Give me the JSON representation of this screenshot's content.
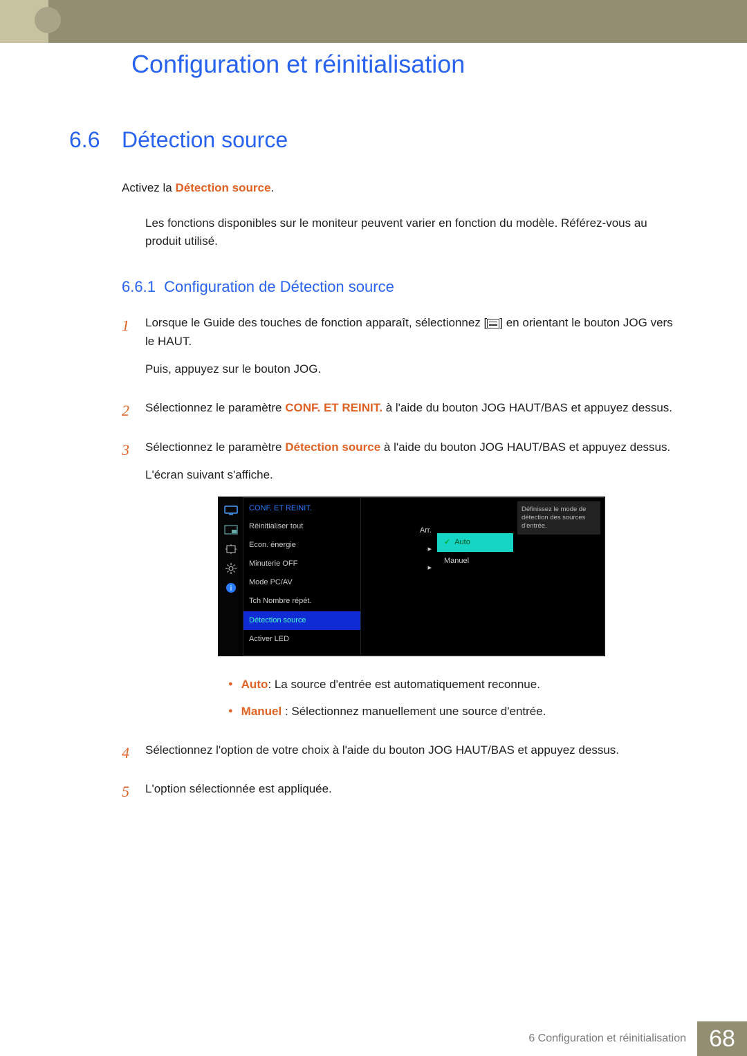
{
  "header": {
    "chapter_title": "Configuration et réinitialisation"
  },
  "section": {
    "number": "6.6",
    "title": "Détection source"
  },
  "intro": {
    "prefix": "Activez la ",
    "kw": "Détection source",
    "suffix": "."
  },
  "note": "Les fonctions disponibles sur le moniteur peuvent varier en fonction du modèle. Référez-vous au produit utilisé.",
  "subsection": {
    "number": "6.6.1",
    "title": "Configuration de Détection source"
  },
  "steps": {
    "s1": {
      "num": "1",
      "p1a": "Lorsque le Guide des touches de fonction apparaît, sélectionnez [",
      "p1b": "] en orientant le bouton JOG vers le HAUT.",
      "p2": "Puis, appuyez sur le bouton JOG."
    },
    "s2": {
      "num": "2",
      "p_a": "Sélectionnez le paramètre ",
      "kw": "CONF. ET REINIT.",
      "p_b": " à l'aide du bouton JOG HAUT/BAS et appuyez dessus."
    },
    "s3": {
      "num": "3",
      "p1_a": "Sélectionnez le paramètre ",
      "kw": "Détection source",
      "p1_b": " à l'aide du bouton JOG HAUT/BAS et appuyez dessus.",
      "p2": "L'écran suivant s'affiche."
    },
    "s4": {
      "num": "4",
      "p": "Sélectionnez l'option de votre choix à l'aide du bouton JOG HAUT/BAS et appuyez dessus."
    },
    "s5": {
      "num": "5",
      "p": "L'option sélectionnée est appliquée."
    }
  },
  "osd": {
    "header": "CONF. ET REINIT.",
    "rows": {
      "r1": "Réinitialiser tout",
      "r2": "Econ. énergie",
      "r3": "Minuterie OFF",
      "r4": "Mode PC/AV",
      "r5": "Tch Nombre répét.",
      "r6": "Détection source",
      "r7": "Activer LED"
    },
    "vals": {
      "v2": "Arr.",
      "v3": "▸",
      "v4": "▸"
    },
    "sub": {
      "o1": "Auto",
      "o2": "Manuel"
    },
    "hint": "Définissez le mode de détection des sources d'entrée."
  },
  "opts": {
    "o1": {
      "kw": "Auto",
      "text": ": La source d'entrée est automatiquement reconnue."
    },
    "o2": {
      "kw": "Manuel",
      "text": " : Sélectionnez manuellement une source d'entrée."
    }
  },
  "footer": {
    "label": "6 Configuration et réinitialisation",
    "page": "68"
  }
}
